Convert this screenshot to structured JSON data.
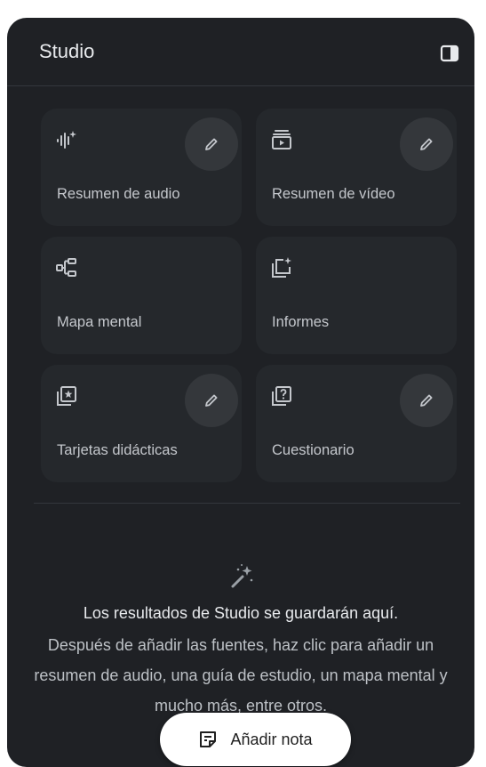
{
  "header": {
    "title": "Studio",
    "toggle_icon": "side-panel-icon"
  },
  "cards": [
    {
      "label": "Resumen de audio",
      "icon": "audio-waveform-sparkle-icon",
      "has_edit": true
    },
    {
      "label": "Resumen de vídeo",
      "icon": "video-overview-icon",
      "has_edit": true
    },
    {
      "label": "Mapa mental",
      "icon": "mind-map-icon",
      "has_edit": false
    },
    {
      "label": "Informes",
      "icon": "reports-sparkle-icon",
      "has_edit": false
    },
    {
      "label": "Tarjetas didácticas",
      "icon": "flashcards-star-icon",
      "has_edit": true
    },
    {
      "label": "Cuestionario",
      "icon": "quiz-question-icon",
      "has_edit": true
    }
  ],
  "empty_state": {
    "icon": "magic-wand-icon",
    "title": "Los resultados de Studio se guardarán aquí.",
    "description": "Después de añadir las fuentes, haz clic para añadir un resumen de audio, una guía de estudio, un mapa mental y mucho más, entre otros."
  },
  "add_note": {
    "label": "Añadir nota",
    "icon": "note-icon"
  },
  "colors": {
    "panel_bg": "#1f2125",
    "card_bg": "#25282c",
    "edit_bg": "#34373b",
    "text_primary": "#e8eaed",
    "text_secondary": "#c4c7cc",
    "fab_bg": "#ffffff"
  }
}
